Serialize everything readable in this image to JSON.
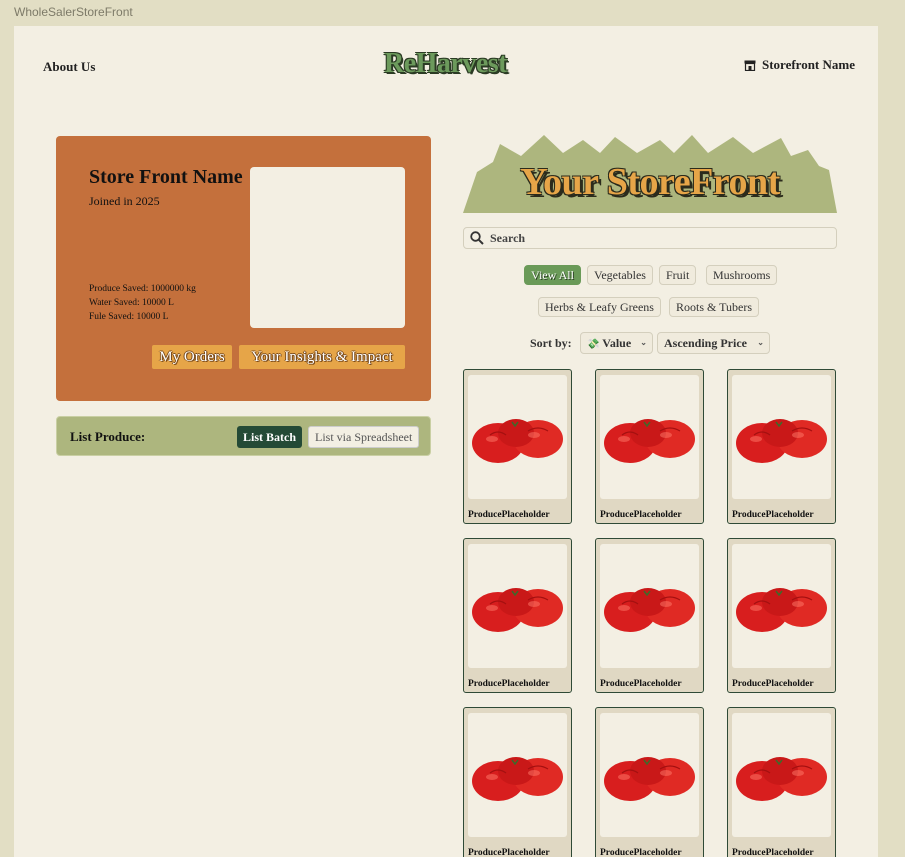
{
  "frame_label": "WholeSalerStoreFront",
  "header": {
    "about_label": "About Us",
    "logo": "ReHarvest",
    "store_link": "Storefront Name"
  },
  "profile": {
    "name": "Store Front Name",
    "joined": "Joined in 2025",
    "stats": [
      "Produce Saved: 1000000 kg",
      "Water Saved: 10000 L",
      "Fule Saved: 10000 L"
    ],
    "orders_button": "My Orders",
    "impact_button": "Your Insights & Impact"
  },
  "list_produce": {
    "label": "List Produce:",
    "batch_button": "List Batch",
    "spreadsheet_button": "List via Spreadsheet"
  },
  "storefront": {
    "title": "Your StoreFront",
    "search_placeholder": "Search",
    "filters": [
      "View All",
      "Vegetables",
      "Fruit",
      "Mushrooms",
      "Herbs & Leafy Greens",
      "Roots & Tubers"
    ],
    "active_filter": "View All",
    "sort_label": "Sort by:",
    "sort_value_emoji": "💸",
    "sort_value": "Value",
    "sort_order": "Ascending Price",
    "products": [
      "ProducePlaceholder",
      "ProducePlaceholder",
      "ProducePlaceholder",
      "ProducePlaceholder",
      "ProducePlaceholder",
      "ProducePlaceholder",
      "ProducePlaceholder",
      "ProducePlaceholder",
      "ProducePlaceholder"
    ]
  },
  "colors": {
    "accent_green": "#6a9a58",
    "dark_green": "#244a36",
    "terracotta": "#c4703c",
    "mustard": "#e6a548",
    "sage": "#adb67e",
    "cream": "#f3efe3"
  }
}
